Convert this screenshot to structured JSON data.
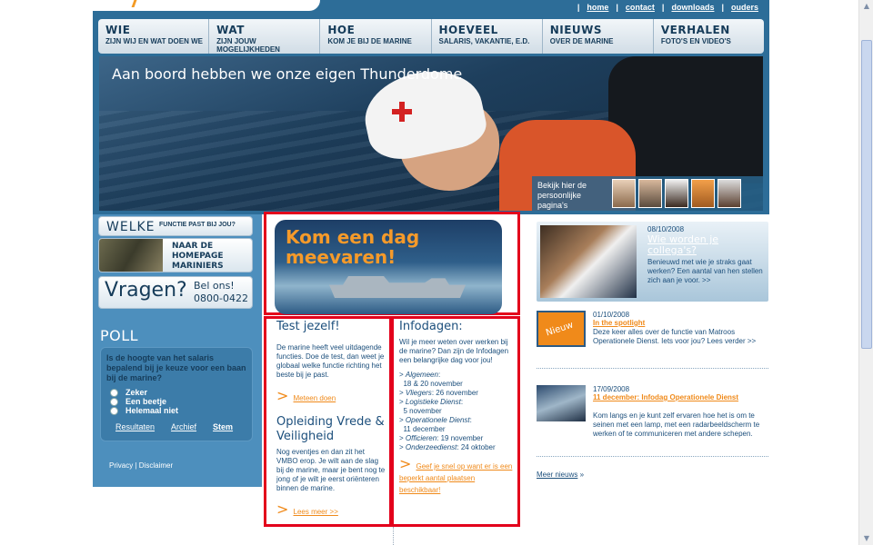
{
  "util_links": [
    "home",
    "contact",
    "downloads",
    "ouders"
  ],
  "nav": [
    {
      "title": "WIE",
      "sub": "ZIJN WIJ EN WAT DOEN WE"
    },
    {
      "title": "WAT",
      "sub": "ZIJN JOUW MOGELIJKHEDEN"
    },
    {
      "title": "HOE",
      "sub": "KOM JE BIJ DE MARINE"
    },
    {
      "title": "HOEVEEL",
      "sub": "SALARIS, VAKANTIE, E.D."
    },
    {
      "title": "NIEUWS",
      "sub": "OVER DE MARINE"
    },
    {
      "title": "VERHALEN",
      "sub": "FOTO'S EN VIDEO'S"
    }
  ],
  "hero": {
    "tagline": "Aan boord hebben we onze eigen Thunderdome",
    "bekijk": "Bekijk hier de persoonlijke pagina's"
  },
  "sidebar": {
    "welke_big": "WELKE",
    "welke_small": "FUNCTIE PAST BIJ JOU?",
    "mariniers": "NAAR DE HOMEPAGE MARINIERS",
    "vragen_big": "Vragen?",
    "vragen_small_1": "Bel ons!",
    "vragen_small_2": "0800-0422"
  },
  "poll": {
    "title": "POLL",
    "question": "Is de hoogte van het salaris bepalend bij je keuze voor een baan bij de marine?",
    "options": [
      "Zeker",
      "Een beetje",
      "Helemaal niet"
    ],
    "links": [
      "Resultaten",
      "Archief",
      "Stem"
    ]
  },
  "footer": {
    "privacy": "Privacy",
    "disclaimer": "Disclaimer"
  },
  "banner": {
    "line1": "Kom een dag",
    "line2": "meevaren!"
  },
  "test": {
    "title": "Test jezelf!",
    "text": "De marine heeft veel uitdagende functies. Doe de test, dan weet je globaal welke functie richting het beste bij je past.",
    "link": "Meteen doen"
  },
  "opleiding": {
    "title": "Opleiding Vrede & Veiligheid",
    "text": "Nog eventjes en dan zit het VMBO erop. Je wilt aan de slag bij de marine, maar je bent nog te jong of je wilt je eerst oriënteren binnen de marine.",
    "link": "Lees meer >>"
  },
  "infodagen": {
    "title": "Infodagen:",
    "intro": "Wil je meer weten over werken bij de marine? Dan zijn de Infodagen een belangrijke dag voor jou!",
    "items": [
      {
        "label": "Algemeen",
        "value": "18 & 20 november"
      },
      {
        "label": "Vliegers",
        "value": "26 november"
      },
      {
        "label": "Logistieke Dienst",
        "value": "5 november"
      },
      {
        "label": "Operationele Dienst",
        "value": "11 december"
      },
      {
        "label": "Officieren",
        "value": "19 november"
      },
      {
        "label": "Onderzeedienst",
        "value": "24 oktober"
      }
    ],
    "link": "Geef je snel op want er is een beperkt aantal plaatsen beschikbaar!"
  },
  "featured": {
    "date": "08/10/2008",
    "title": "Wie worden je collega's?",
    "text": "Benieuwd met wie je straks gaat werken? Een aantal van hen stellen zich aan je voor. >>"
  },
  "news": [
    {
      "date": "01/10/2008",
      "title": "In the spotlight",
      "text": "Deze keer alles over de functie van Matroos Operationele Dienst. Iets voor jou? Lees verder >>",
      "badge": "Nieuw"
    },
    {
      "date": "17/09/2008",
      "title": "11 december: Infodag Operationele Dienst",
      "text": "Kom langs en je kunt zelf ervaren hoe het is om te seinen met een lamp, met een radarbeeldscherm te werken of te communiceren met andere schepen."
    }
  ],
  "meer": "Meer nieuws"
}
